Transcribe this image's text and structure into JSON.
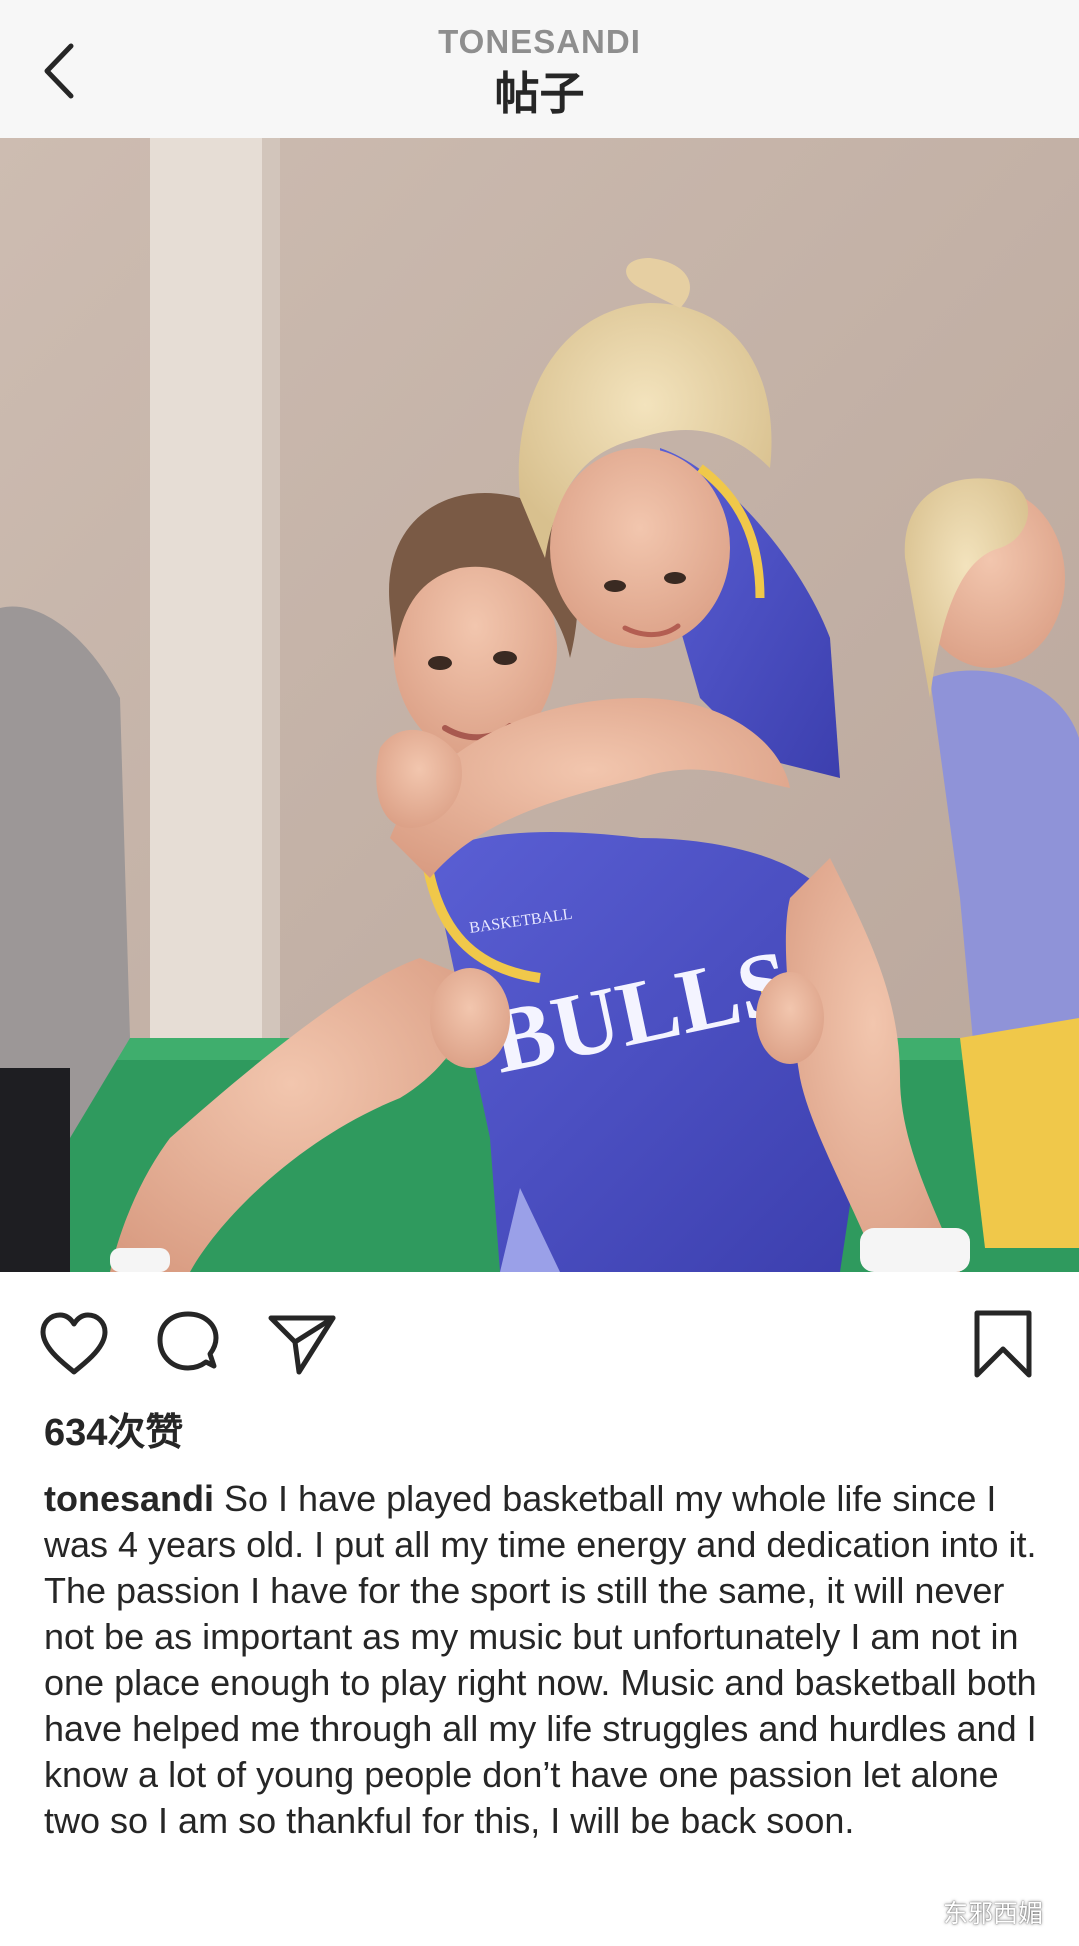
{
  "header": {
    "account": "TONESANDI",
    "title": "帖子"
  },
  "photo": {
    "jersey_text": "BULLS",
    "jersey_small_text": "BASKETBALL",
    "colors": {
      "wall": "#c8b7ac",
      "jersey": "#4b4fc4",
      "jersey_trim": "#f0c84a",
      "floor": "#2f9a5e"
    }
  },
  "actions": {
    "icons": [
      "heart-icon",
      "comment-icon",
      "send-icon",
      "bookmark-icon"
    ]
  },
  "likes": {
    "text": "634次赞"
  },
  "caption": {
    "username": "tonesandi",
    "text": " So I have played basketball my whole life since I was 4 years old. I put all my time energy and dedication into it. The passion I have for the sport is still the same, it will never not be as important as my music but unfortunately I am not in one place enough to play right now. Music and basketball both have helped me through all my life struggles and hurdles and I know a lot of young people don’t have one passion let alone two so I am so thankful for this, I will be back soon."
  },
  "watermark": {
    "text": "东邪西媚"
  }
}
